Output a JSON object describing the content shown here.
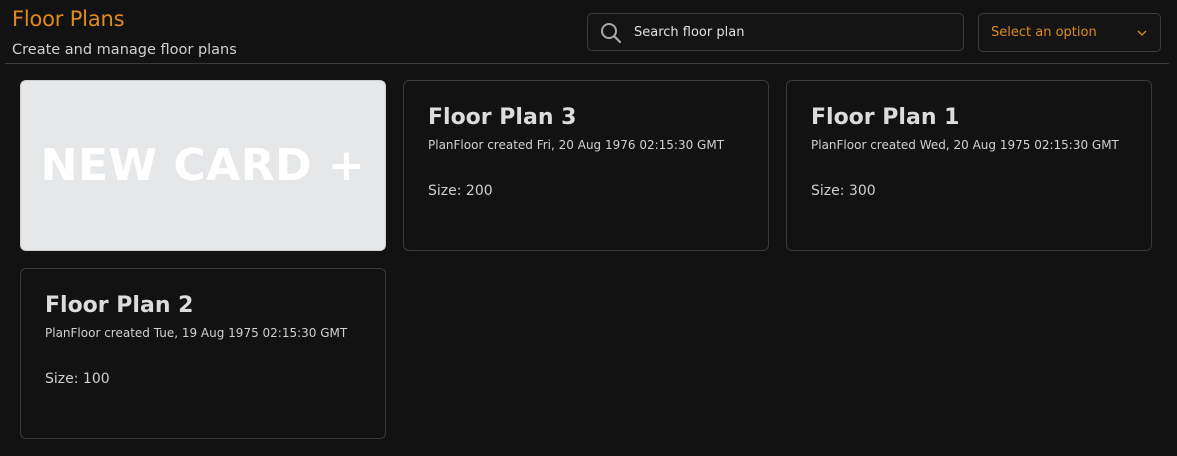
{
  "header": {
    "title": "Floor Plans",
    "subtitle": "Create and manage floor plans"
  },
  "search": {
    "placeholder": "Search floor plan",
    "icon": "search-icon"
  },
  "select": {
    "selected": "Select an option",
    "icon": "chevron-down-icon"
  },
  "new_card": {
    "label": "NEW CARD +"
  },
  "cards": [
    {
      "title": "Floor Plan 3",
      "created": "PlanFloor created Fri, 20 Aug 1976 02:15:30 GMT",
      "size": "Size: 200"
    },
    {
      "title": "Floor Plan 1",
      "created": "PlanFloor created Wed, 20 Aug 1975 02:15:30 GMT",
      "size": "Size: 300"
    },
    {
      "title": "Floor Plan 2",
      "created": "PlanFloor created Tue, 19 Aug 1975 02:15:30 GMT",
      "size": "Size: 100"
    }
  ],
  "colors": {
    "accent": "#e08a1e",
    "background": "#121212",
    "new_card_bg": "#e6e7e9",
    "card_border": "#3a3a3a"
  }
}
